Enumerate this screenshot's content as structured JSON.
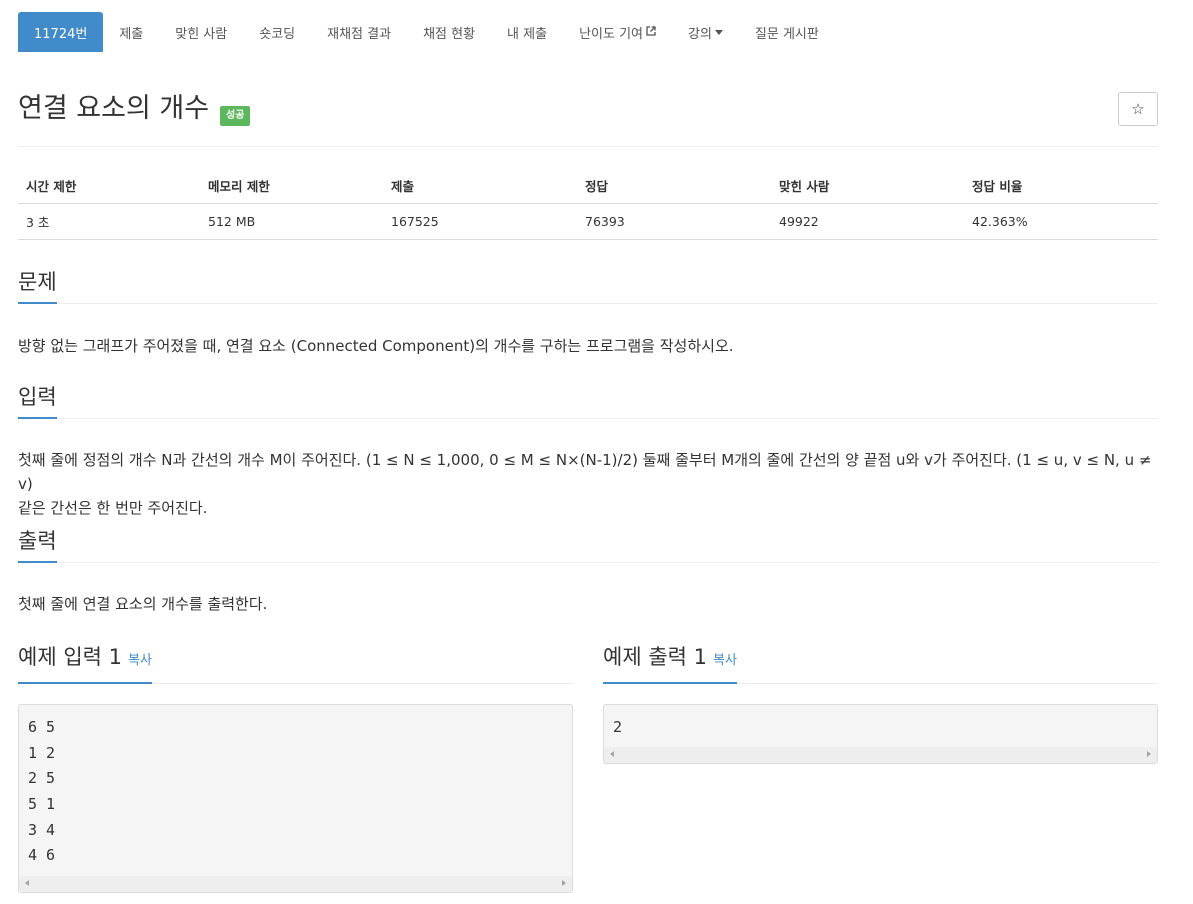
{
  "tabs": [
    {
      "label": "11724번",
      "active": true
    },
    {
      "label": "제출"
    },
    {
      "label": "맞힌 사람"
    },
    {
      "label": "숏코딩"
    },
    {
      "label": "재채점 결과"
    },
    {
      "label": "채점 현황"
    },
    {
      "label": "내 제출"
    },
    {
      "label": "난이도 기여"
    },
    {
      "label": "강의"
    },
    {
      "label": "질문 게시판"
    }
  ],
  "problem": {
    "title": "연결 요소의 개수",
    "status_badge": "성공",
    "star_icon": "☆"
  },
  "stats": {
    "headers": [
      "시간 제한",
      "메모리 제한",
      "제출",
      "정답",
      "맞힌 사람",
      "정답 비율"
    ],
    "values": [
      "3 초",
      "512 MB",
      "167525",
      "76393",
      "49922",
      "42.363%"
    ]
  },
  "sections": {
    "description": {
      "heading": "문제",
      "text": "방향 없는 그래프가 주어졌을 때, 연결 요소 (Connected Component)의 개수를 구하는 프로그램을 작성하시오."
    },
    "input": {
      "heading": "입력",
      "line1": "첫째 줄에 정점의 개수 N과 간선의 개수 M이 주어진다. (1 ≤ N ≤ 1,000, 0 ≤ M ≤ N×(N-1)/2) 둘째 줄부터 M개의 줄에 간선의 양 끝점 u와 v가 주어진다. (1 ≤ u, v ≤ N, u ≠ v)",
      "line2": "같은 간선은 한 번만 주어진다."
    },
    "output": {
      "heading": "출력",
      "text": "첫째 줄에 연결 요소의 개수를 출력한다."
    }
  },
  "samples": {
    "input": {
      "heading": "예제 입력 1",
      "copy_label": "복사",
      "lines": [
        "6 5",
        "1 2",
        "2 5",
        "5 1",
        "3 4",
        "4 6"
      ]
    },
    "output": {
      "heading": "예제 출력 1",
      "copy_label": "복사",
      "lines": [
        "2"
      ]
    }
  },
  "colors": {
    "accent": "#428bca",
    "success": "#5cb85c"
  }
}
